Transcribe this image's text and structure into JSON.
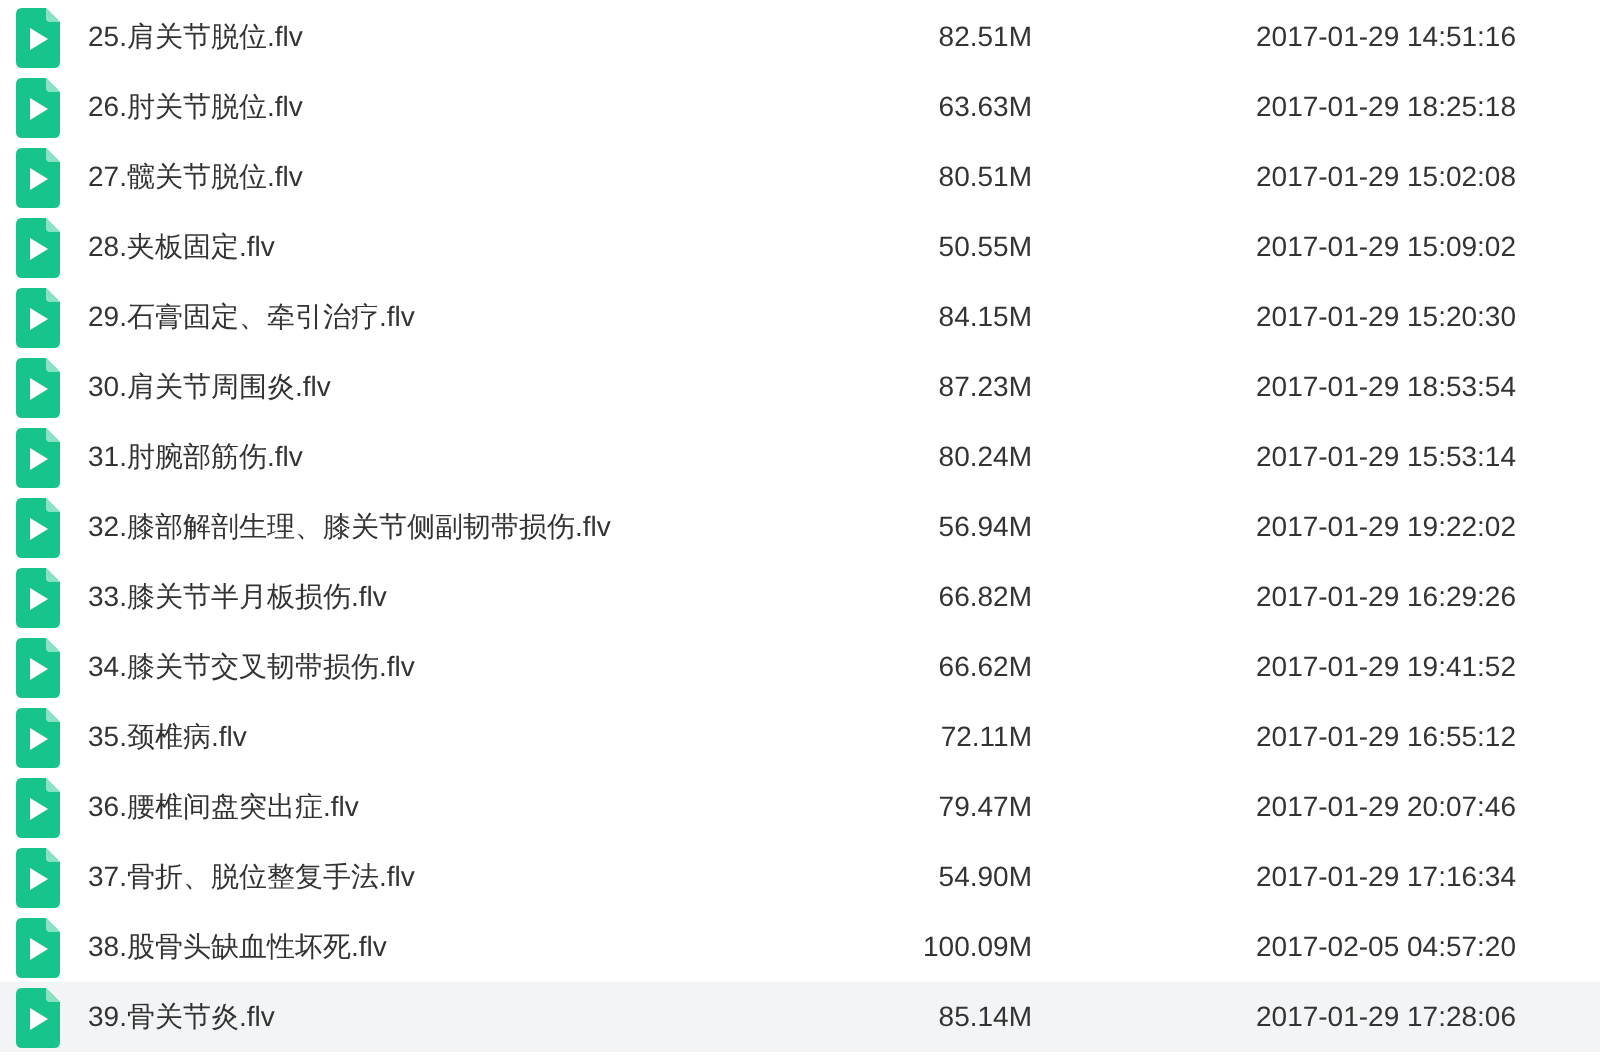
{
  "files": [
    {
      "name": "25.肩关节脱位.flv",
      "size": "82.51M",
      "modified": "2017-01-29 14:51:16",
      "selected": false
    },
    {
      "name": "26.肘关节脱位.flv",
      "size": "63.63M",
      "modified": "2017-01-29 18:25:18",
      "selected": false
    },
    {
      "name": "27.髋关节脱位.flv",
      "size": "80.51M",
      "modified": "2017-01-29 15:02:08",
      "selected": false
    },
    {
      "name": "28.夹板固定.flv",
      "size": "50.55M",
      "modified": "2017-01-29 15:09:02",
      "selected": false
    },
    {
      "name": "29.石膏固定、牵引治疗.flv",
      "size": "84.15M",
      "modified": "2017-01-29 15:20:30",
      "selected": false
    },
    {
      "name": "30.肩关节周围炎.flv",
      "size": "87.23M",
      "modified": "2017-01-29 18:53:54",
      "selected": false
    },
    {
      "name": "31.肘腕部筋伤.flv",
      "size": "80.24M",
      "modified": "2017-01-29 15:53:14",
      "selected": false
    },
    {
      "name": "32.膝部解剖生理、膝关节侧副韧带损伤.flv",
      "size": "56.94M",
      "modified": "2017-01-29 19:22:02",
      "selected": false
    },
    {
      "name": "33.膝关节半月板损伤.flv",
      "size": "66.82M",
      "modified": "2017-01-29 16:29:26",
      "selected": false
    },
    {
      "name": "34.膝关节交叉韧带损伤.flv",
      "size": "66.62M",
      "modified": "2017-01-29 19:41:52",
      "selected": false
    },
    {
      "name": "35.颈椎病.flv",
      "size": "72.11M",
      "modified": "2017-01-29 16:55:12",
      "selected": false
    },
    {
      "name": "36.腰椎间盘突出症.flv",
      "size": "79.47M",
      "modified": "2017-01-29 20:07:46",
      "selected": false
    },
    {
      "name": "37.骨折、脱位整复手法.flv",
      "size": "54.90M",
      "modified": "2017-01-29 17:16:34",
      "selected": false
    },
    {
      "name": "38.股骨头缺血性坏死.flv",
      "size": "100.09M",
      "modified": "2017-02-05 04:57:20",
      "selected": false
    },
    {
      "name": "39.骨关节炎.flv",
      "size": "85.14M",
      "modified": "2017-01-29 17:28:06",
      "selected": true
    }
  ]
}
